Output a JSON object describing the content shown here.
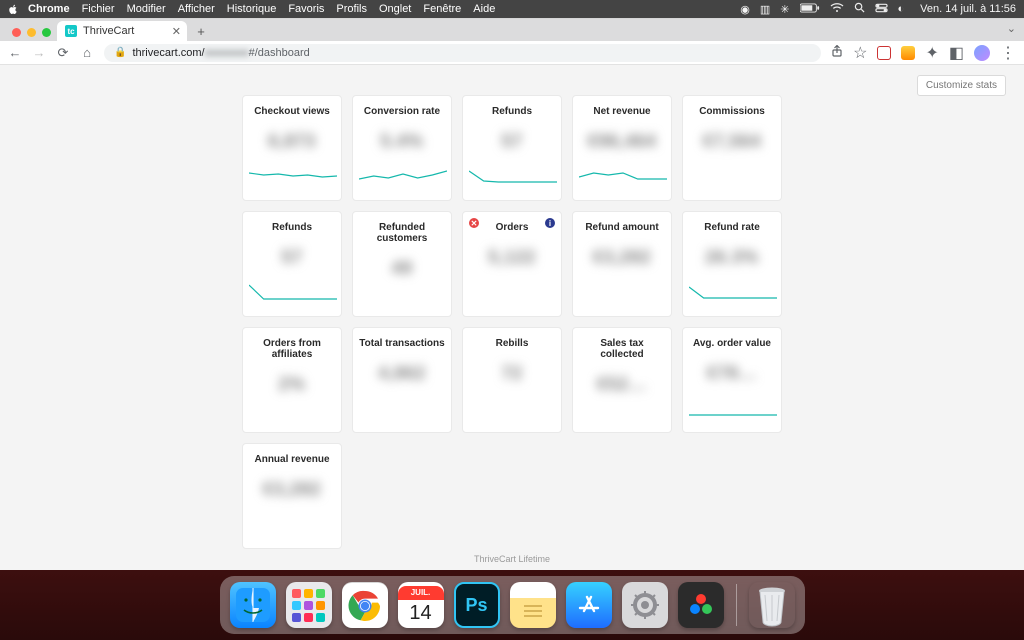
{
  "menubar": {
    "app": "Chrome",
    "items": [
      "Fichier",
      "Modifier",
      "Afficher",
      "Historique",
      "Favoris",
      "Profils",
      "Onglet",
      "Fenêtre",
      "Aide"
    ],
    "clock": "Ven. 14 juil. à 11:56"
  },
  "browser": {
    "tab_title": "ThriveCart",
    "url_host": "thrivecart.com/",
    "url_middle_hidden": "xxxxxxxx",
    "url_fragment": "#/dashboard"
  },
  "page": {
    "customize_label": "Customize stats",
    "footer": "ThriveCart Lifetime",
    "cards": [
      {
        "title": "Checkout views",
        "value": "6,873",
        "spark": [
          8,
          10,
          9,
          11,
          10,
          12,
          11
        ]
      },
      {
        "title": "Conversion rate",
        "value": "5.4%",
        "spark": [
          14,
          11,
          13,
          9,
          13,
          10,
          6
        ]
      },
      {
        "title": "Refunds",
        "value": "57",
        "spark": [
          6,
          16,
          17,
          17,
          17,
          17,
          17
        ]
      },
      {
        "title": "Net revenue",
        "value": "€96,464",
        "spark": [
          12,
          8,
          10,
          8,
          14,
          14,
          14
        ]
      },
      {
        "title": "Commissions",
        "value": "€7,564",
        "spark": null
      },
      {
        "title": "Refunds",
        "value": "57",
        "spark": [
          4,
          18,
          18,
          18,
          18,
          18,
          18
        ]
      },
      {
        "title": "Refunded customers",
        "value": "49",
        "spark": null
      },
      {
        "title": "Orders",
        "value": "5,122",
        "spark": null,
        "badge_del": true,
        "badge_info": true
      },
      {
        "title": "Refund amount",
        "value": "€3,282",
        "spark": null
      },
      {
        "title": "Refund rate",
        "value": "26.3%",
        "spark": [
          6,
          17,
          17,
          17,
          17,
          17,
          17
        ]
      },
      {
        "title": "Orders from affiliates",
        "value": "2%",
        "spark": null
      },
      {
        "title": "Total transactions",
        "value": "4,862",
        "spark": null
      },
      {
        "title": "Rebills",
        "value": "72",
        "spark": null
      },
      {
        "title": "Sales tax collected",
        "value": "€52…",
        "spark": null
      },
      {
        "title": "Avg. order value",
        "value": "€78…",
        "spark": [
          18,
          18,
          18,
          18,
          18,
          18,
          18
        ]
      },
      {
        "title": "Annual revenue",
        "value": "€3,282",
        "spark": null
      }
    ]
  },
  "dock": {
    "calendar_month": "JUIL.",
    "calendar_day": "14",
    "ps": "Ps"
  }
}
